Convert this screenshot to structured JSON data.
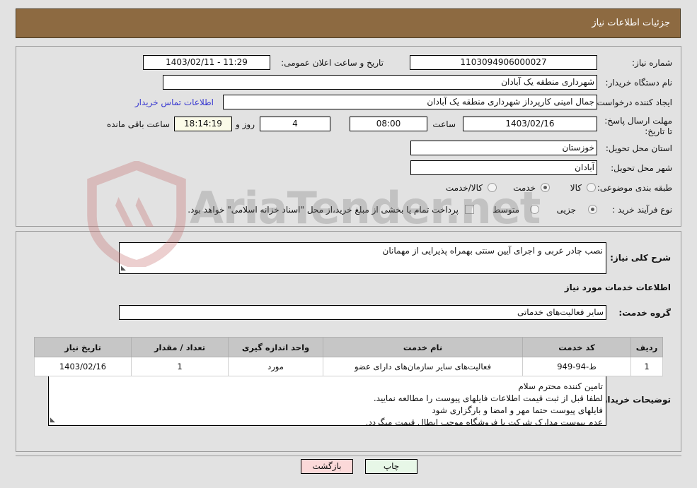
{
  "header": {
    "title": "جزئیات اطلاعات نیاز"
  },
  "watermark": {
    "text": "AriaTender.net",
    "logo_icon": "shield-logo-icon",
    "color": "#787878"
  },
  "main": {
    "need_number_label": "شماره نیاز:",
    "need_number_value": "1103094906000027",
    "public_announce_label": "تاریخ و ساعت اعلان عمومی:",
    "public_announce_value": "11:29 - 1403/02/11",
    "buyer_org_label": "نام دستگاه خریدار:",
    "buyer_org_value": "شهرداری منطقه یک آبادان",
    "creator_label": "ایجاد کننده درخواست:",
    "creator_value": "جمال امینی کارپرداز شهرداری منطقه یک آبادان",
    "contact_link": "اطلاعات تماس خریدار",
    "deadline_label": "مهلت ارسال پاسخ: تا تاریخ:",
    "deadline_date": "1403/02/16",
    "deadline_hour_label": "ساعت",
    "deadline_hour_value": "08:00",
    "days_value": "4",
    "days_label": "روز و",
    "countdown_value": "18:14:19",
    "countdown_label": "ساعت باقی مانده",
    "province_label": "استان محل تحویل:",
    "province_value": "خوزستان",
    "city_label": "شهر محل تحویل:",
    "city_value": "آبادان",
    "category_label": "طبقه بندی موضوعی:",
    "category_options": [
      {
        "label": "کالا",
        "selected": false
      },
      {
        "label": "خدمت",
        "selected": true
      },
      {
        "label": "کالا/خدمت",
        "selected": false
      }
    ],
    "process_label": "نوع فرآیند خرید :",
    "process_options": [
      {
        "label": "جزیی",
        "selected": true
      },
      {
        "label": "متوسط",
        "selected": false
      }
    ],
    "treasury_checkbox_label": "پرداخت تمام یا بخشی از مبلغ خرید،از محل \"اسناد خزانه اسلامی\" خواهد بود.",
    "treasury_checked": false
  },
  "description": {
    "general_need_label": "شرح کلی نیاز:",
    "general_need_value": "نصب چادر عربی و اجرای آیین سنتی بهمراه پذیرایی از مهمانان",
    "services_section_title": "اطلاعات خدمات مورد نیاز",
    "service_group_label": "گروه خدمت:",
    "service_group_value": "سایر فعالیت‌های خدماتی",
    "buyer_notes_label": "توضیحات خریدار:",
    "buyer_notes_value": "تامین کننده محترم سلام\nلطفا قبل از ثبت قیمت اطلاعات فایلهای پیوست را مطالعه نمایید.\nفایلهای پیوست حتما مهر و امضا و بارگزاری شود\nعدم پیوست مدارک شرکت یا فروشگاه موجب ابطال قیمت میگردد."
  },
  "table": {
    "headers": [
      "ردیف",
      "کد خدمت",
      "نام خدمت",
      "واحد اندازه گیری",
      "تعداد / مقدار",
      "تاریخ نیاز"
    ],
    "rows": [
      {
        "index": "1",
        "service_code": "ط-94-949",
        "service_name": "فعالیت‌های سایر سازمان‌های دارای عضو",
        "unit": "مورد",
        "quantity": "1",
        "need_date": "1403/02/16"
      }
    ]
  },
  "footer": {
    "print_label": "چاپ",
    "back_label": "بازگشت",
    "print_color": "#e7f7e7",
    "back_color": "#fbd9d9"
  }
}
